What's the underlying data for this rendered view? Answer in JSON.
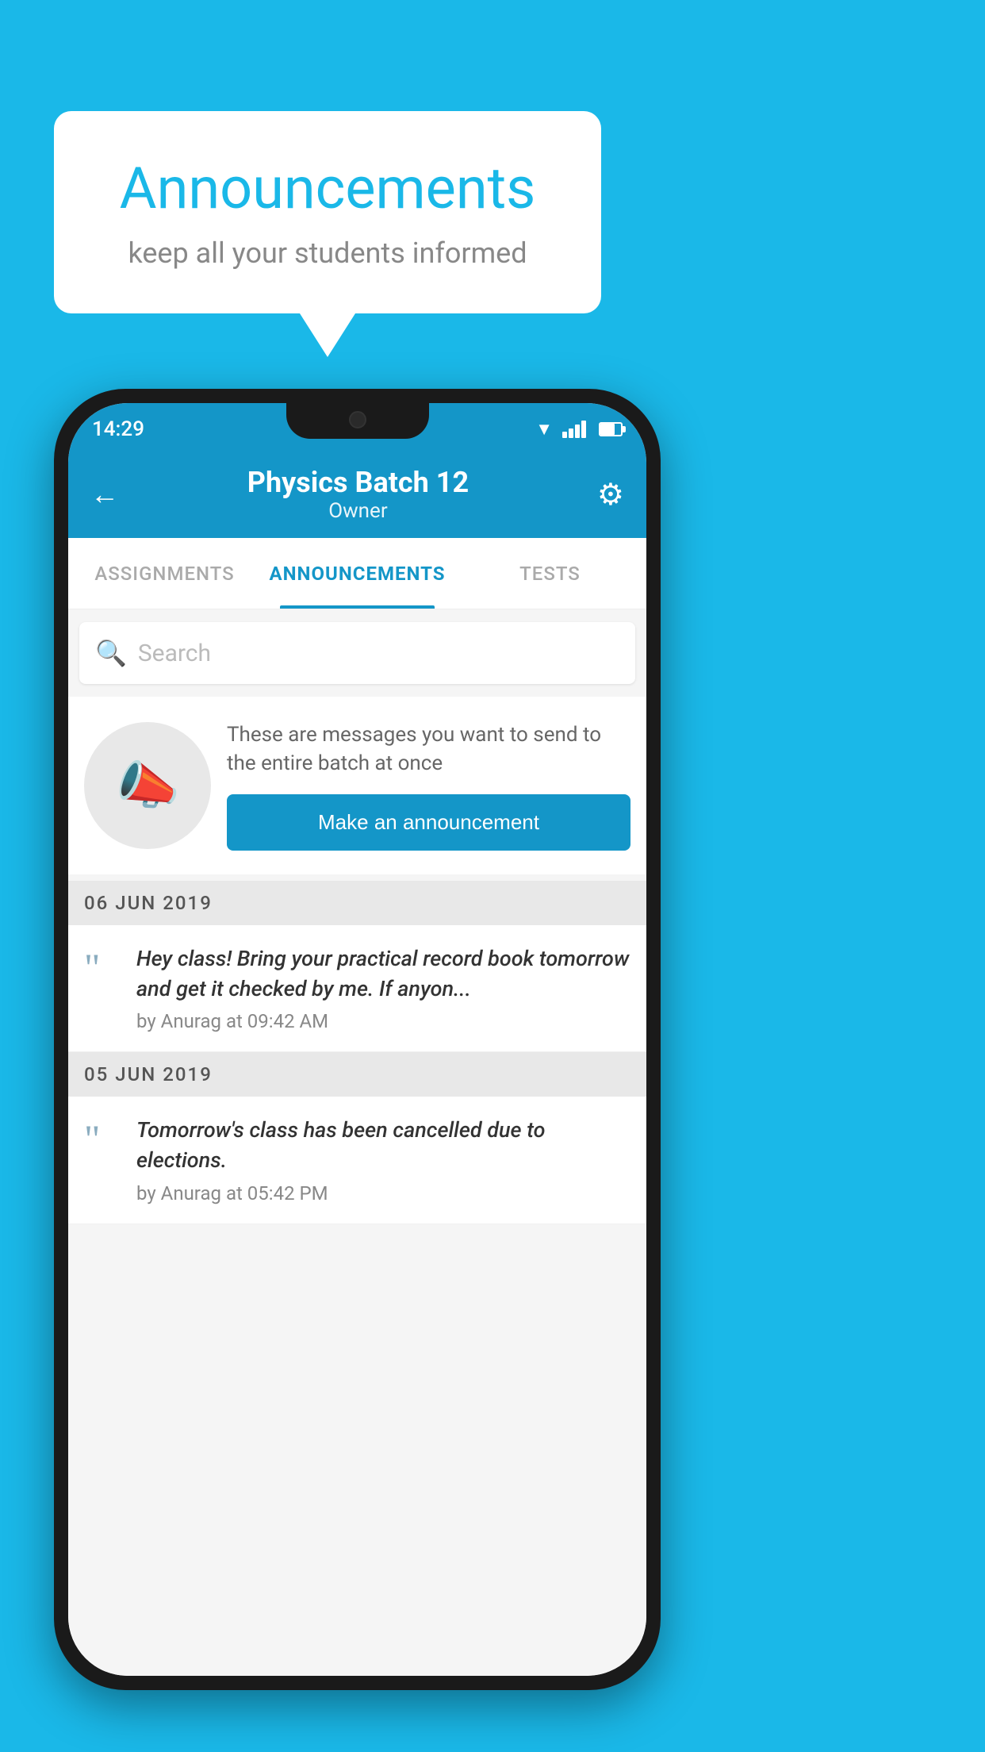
{
  "background_color": "#1ab8e8",
  "speech_bubble": {
    "title": "Announcements",
    "subtitle": "keep all your students informed"
  },
  "phone": {
    "status_bar": {
      "time": "14:29"
    },
    "app_bar": {
      "back_label": "←",
      "title": "Physics Batch 12",
      "subtitle": "Owner",
      "gear_label": "⚙"
    },
    "tabs": [
      {
        "label": "ASSIGNMENTS",
        "active": false
      },
      {
        "label": "ANNOUNCEMENTS",
        "active": true
      },
      {
        "label": "TESTS",
        "active": false
      }
    ],
    "search": {
      "placeholder": "Search"
    },
    "cta": {
      "description": "These are messages you want to send to the entire batch at once",
      "button_label": "Make an announcement"
    },
    "announcements": [
      {
        "date": "06  JUN  2019",
        "text": "Hey class! Bring your practical record book tomorrow and get it checked by me. If anyon...",
        "meta": "by Anurag at 09:42 AM"
      },
      {
        "date": "05  JUN  2019",
        "text": "Tomorrow's class has been cancelled due to elections.",
        "meta": "by Anurag at 05:42 PM"
      }
    ]
  }
}
